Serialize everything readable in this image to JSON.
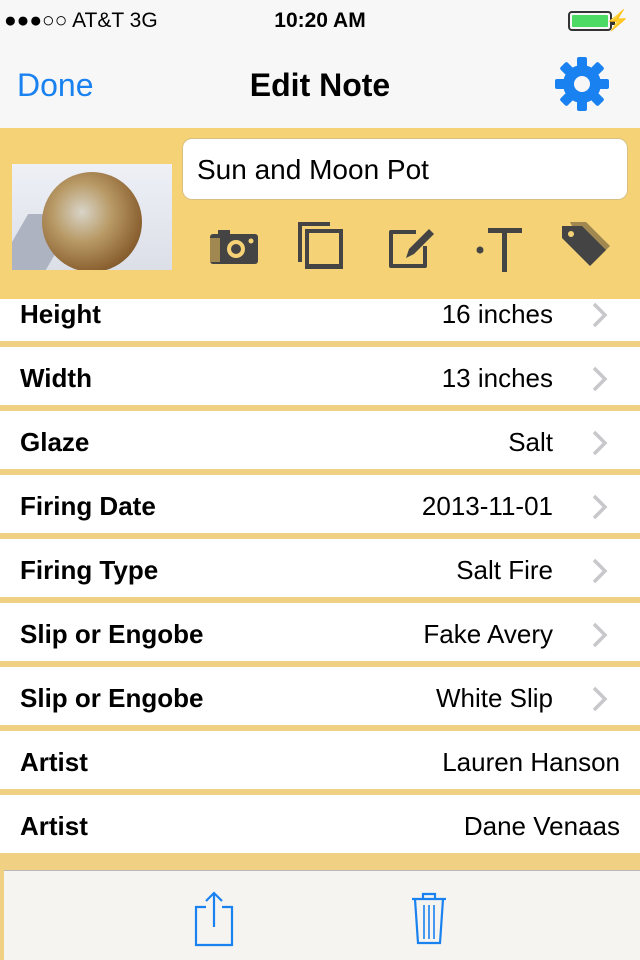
{
  "status": {
    "carrier": "●●●○○ AT&T   3G",
    "time": "10:20 AM",
    "battery_level": 1.0
  },
  "nav": {
    "done": "Done",
    "title": "Edit Note",
    "settings_icon": "gear-icon"
  },
  "note": {
    "name": "Sun and Moon Pot",
    "tools": [
      "camera-icon",
      "copy-icon",
      "edit-icon",
      "text-icon",
      "tag-icon"
    ]
  },
  "fields": [
    {
      "label": "Height",
      "value": "16 inches",
      "chevron": true
    },
    {
      "label": "Width",
      "value": "13 inches",
      "chevron": true
    },
    {
      "label": "Glaze",
      "value": "Salt",
      "chevron": true
    },
    {
      "label": "Firing Date",
      "value": "2013-11-01",
      "chevron": true
    },
    {
      "label": "Firing Type",
      "value": "Salt Fire",
      "chevron": true
    },
    {
      "label": "Slip or Engobe",
      "value": "Fake Avery",
      "chevron": true
    },
    {
      "label": "Slip or Engobe",
      "value": "White Slip",
      "chevron": true
    },
    {
      "label": "Artist",
      "value": "Lauren Hanson",
      "chevron": false
    },
    {
      "label": "Artist",
      "value": "Dane Venaas",
      "chevron": false
    }
  ],
  "toolbar": [
    "share-icon",
    "trash-icon"
  ],
  "colors": {
    "accent": "#1a82f0",
    "header": "#f5d275",
    "separator": "#f0d184"
  }
}
